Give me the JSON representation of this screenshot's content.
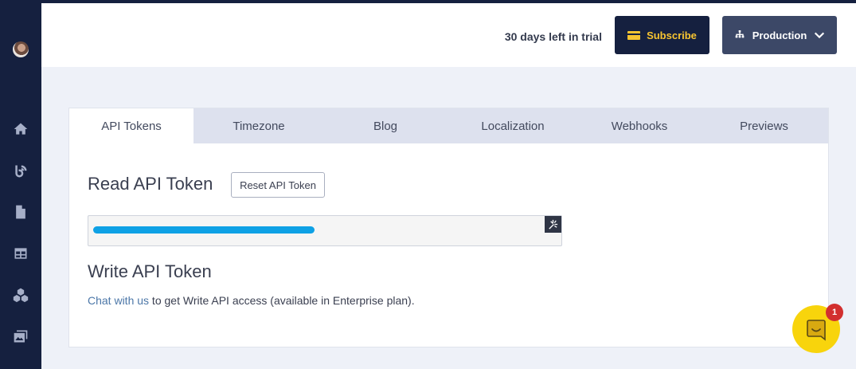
{
  "header": {
    "trial_text": "30 days left in trial",
    "subscribe_label": "Subscribe",
    "environment_label": "Production"
  },
  "sidebar": {
    "icons": [
      "avatar",
      "home-icon",
      "blog-icon",
      "document-icon",
      "table-icon",
      "modules-icon",
      "media-icon"
    ]
  },
  "tabs": [
    {
      "label": "API Tokens",
      "active": true
    },
    {
      "label": "Timezone",
      "active": false
    },
    {
      "label": "Blog",
      "active": false
    },
    {
      "label": "Localization",
      "active": false
    },
    {
      "label": "Webhooks",
      "active": false
    },
    {
      "label": "Previews",
      "active": false
    }
  ],
  "read_token": {
    "title": "Read API Token",
    "reset_label": "Reset API Token"
  },
  "write_token": {
    "title": "Write API Token",
    "link_text": "Chat with us",
    "description": " to get Write API access (available in Enterprise plan)."
  },
  "chat": {
    "badge_count": "1"
  },
  "colors": {
    "sidebar_bg": "#15203f",
    "subscribe_text": "#f7c431",
    "environment_bg": "#3c4867",
    "chat_bubble": "#f8d40c",
    "badge": "#d22f2f",
    "link": "#4c77a8"
  }
}
